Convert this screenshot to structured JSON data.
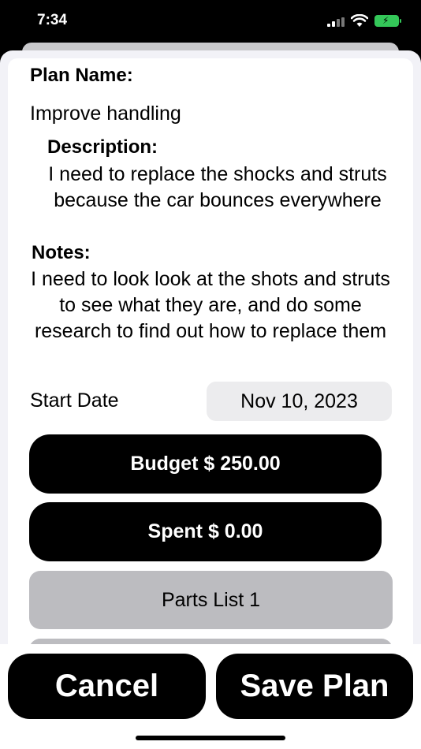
{
  "status": {
    "time": "7:34",
    "battery_color": "#34c759"
  },
  "form": {
    "plan_name_label": "Plan Name:",
    "plan_name_value": "Improve handling",
    "description_label": "Description:",
    "description_text": "I need to replace the shocks and struts because the car bounces everywhere",
    "notes_label": "Notes:",
    "notes_text": "I need to look look at the shots and struts to see what they are, and do some research to find out how to replace them",
    "start_date_label": "Start Date",
    "start_date_value": "Nov 10, 2023"
  },
  "buttons": {
    "budget_label": "Budget $ 250.00",
    "spent_label": "Spent $ 0.00",
    "parts_list_label": "Parts List 1"
  },
  "footer": {
    "cancel_label": "Cancel",
    "save_label": "Save Plan"
  }
}
